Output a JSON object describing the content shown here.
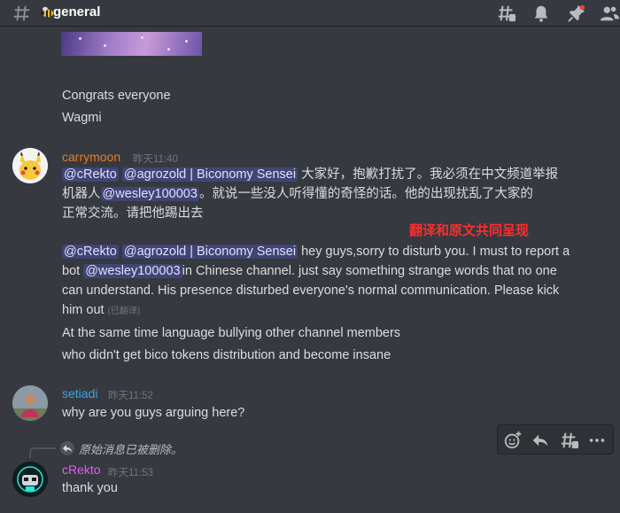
{
  "header": {
    "channel_name": "general",
    "icons": [
      "hash-icon",
      "threads-icon",
      "bell-icon",
      "pin-icon",
      "members-icon"
    ]
  },
  "messages": {
    "prev": {
      "line1": "Congrats everyone",
      "line2": "Wagmi"
    },
    "carrymoon": {
      "author": "carrymoon",
      "timestamp": "昨天11:40",
      "author_color": "#e67e22",
      "mention_cRekto": "@cRekto",
      "mention_agrozold": "@agrozold | Biconomy Sensei",
      "mention_wesley": "@wesley100003",
      "zh_line1_rest": " 大家好，抱歉打扰了。我必须在中文频道举报",
      "zh_line2_prefix": "机器人",
      "zh_line2_rest": "。就说一些没人听得懂的奇怪的话。他的出现扰乱了大家的",
      "zh_line3": "正常交流。请把他踢出去",
      "en_line1_rest": " hey guys,sorry to disturb you. I must to report a",
      "en_line2_prefix": "bot ",
      "en_line2_rest": "in Chinese channel. just say something strange words that no one",
      "en_line3": "can understand. His presence disturbed everyone's normal communication. Please kick",
      "en_line4": "him out",
      "edited_label": "(已翻译)",
      "extra_line1": "At the same time language bullying other channel members",
      "extra_line2": "who didn't get bico tokens distribution and become insane"
    },
    "setiadi": {
      "author": "setiadi",
      "timestamp": "昨天11:52",
      "author_color": "#3ba4e6",
      "text": "why are you guys arguing here?"
    },
    "cRekto": {
      "author": "cRekto",
      "timestamp": "昨天11:53",
      "author_color": "#e05ef2",
      "reply_deleted": "原始消息已被删除。",
      "text": "thank you"
    }
  },
  "annotation": "翻译和原文共同呈现",
  "toolbar": {
    "icons": [
      "add-reaction-icon",
      "reply-icon",
      "create-thread-icon",
      "more-icon"
    ]
  }
}
